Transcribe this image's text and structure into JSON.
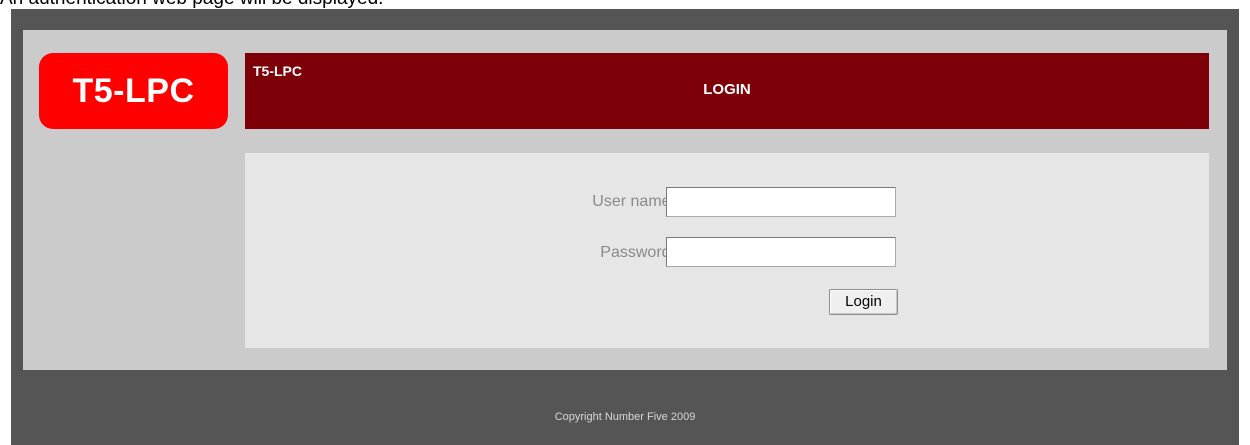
{
  "caption": "An authentication web page will be displayed.",
  "logo": {
    "text": "T5-LPC"
  },
  "banner": {
    "small_title": "T5-LPC",
    "title": "LOGIN"
  },
  "form": {
    "username_label": "User name:",
    "username_value": "",
    "password_label": "Password:",
    "password_value": "",
    "login_label": "Login"
  },
  "footer": {
    "text": "Copyright Number Five 2009"
  },
  "colors": {
    "frame": "#555555",
    "panel": "#cbcbcb",
    "logo": "#fe0000",
    "banner": "#7d0009",
    "content": "#e6e6e6"
  }
}
